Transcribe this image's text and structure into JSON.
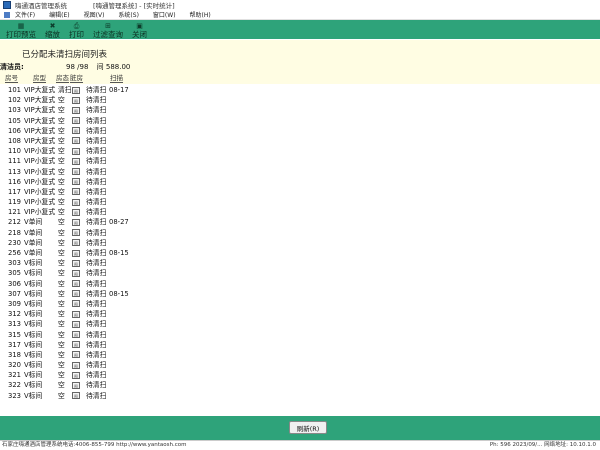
{
  "window": {
    "app_title": "嗨通酒店管理系统",
    "doc_title": "[嗨通管理系统] - [实时统计]"
  },
  "menu": [
    "文件(F)",
    "编辑(E)",
    "视图(V)",
    "系统(S)",
    "窗口(W)",
    "帮助(H)"
  ],
  "toolbar": [
    {
      "label": "打印预览",
      "icon": "▦"
    },
    {
      "label": "缩放",
      "icon": "✖"
    },
    {
      "label": "打印",
      "icon": "⎙"
    },
    {
      "label": "过滤查询",
      "icon": "⊞"
    },
    {
      "label": "关闭",
      "icon": "▣"
    }
  ],
  "report": {
    "title": "已分配未清扫房间列表",
    "cleaner_label": "清洁员:",
    "count": "98 /98",
    "amount": "间 588.00"
  },
  "columns": [
    "房号",
    "房型",
    "房态",
    "脏房",
    "扫描"
  ],
  "rows": [
    {
      "no": "101",
      "type": "VIP大复式",
      "status": "清扫",
      "state": "待清扫",
      "date": "08-17"
    },
    {
      "no": "102",
      "type": "VIP大复式",
      "status": "空",
      "state": "待清扫",
      "date": ""
    },
    {
      "no": "103",
      "type": "VIP大复式",
      "status": "空",
      "state": "待清扫",
      "date": ""
    },
    {
      "no": "105",
      "type": "VIP大复式",
      "status": "空",
      "state": "待清扫",
      "date": ""
    },
    {
      "no": "106",
      "type": "VIP大复式",
      "status": "空",
      "state": "待清扫",
      "date": ""
    },
    {
      "no": "108",
      "type": "VIP大复式",
      "status": "空",
      "state": "待清扫",
      "date": ""
    },
    {
      "no": "110",
      "type": "VIP小复式",
      "status": "空",
      "state": "待清扫",
      "date": ""
    },
    {
      "no": "111",
      "type": "VIP小复式",
      "status": "空",
      "state": "待清扫",
      "date": ""
    },
    {
      "no": "113",
      "type": "VIP小复式",
      "status": "空",
      "state": "待清扫",
      "date": ""
    },
    {
      "no": "116",
      "type": "VIP小复式",
      "status": "空",
      "state": "待清扫",
      "date": ""
    },
    {
      "no": "117",
      "type": "VIP小复式",
      "status": "空",
      "state": "待清扫",
      "date": ""
    },
    {
      "no": "119",
      "type": "VIP小复式",
      "status": "空",
      "state": "待清扫",
      "date": ""
    },
    {
      "no": "121",
      "type": "VIP小复式",
      "status": "空",
      "state": "待清扫",
      "date": ""
    },
    {
      "no": "212",
      "type": "V单间",
      "status": "空",
      "state": "待清扫",
      "date": "08-27"
    },
    {
      "no": "218",
      "type": "V单间",
      "status": "空",
      "state": "待清扫",
      "date": ""
    },
    {
      "no": "230",
      "type": "V单间",
      "status": "空",
      "state": "待清扫",
      "date": ""
    },
    {
      "no": "256",
      "type": "V单间",
      "status": "空",
      "state": "待清扫",
      "date": "08-15"
    },
    {
      "no": "303",
      "type": "V标间",
      "status": "空",
      "state": "待清扫",
      "date": ""
    },
    {
      "no": "305",
      "type": "V标间",
      "status": "空",
      "state": "待清扫",
      "date": ""
    },
    {
      "no": "306",
      "type": "V标间",
      "status": "空",
      "state": "待清扫",
      "date": ""
    },
    {
      "no": "307",
      "type": "V标间",
      "status": "空",
      "state": "待清扫",
      "date": "08-15"
    },
    {
      "no": "309",
      "type": "V标间",
      "status": "空",
      "state": "待清扫",
      "date": ""
    },
    {
      "no": "312",
      "type": "V标间",
      "status": "空",
      "state": "待清扫",
      "date": ""
    },
    {
      "no": "313",
      "type": "V标间",
      "status": "空",
      "state": "待清扫",
      "date": ""
    },
    {
      "no": "315",
      "type": "V标间",
      "status": "空",
      "state": "待清扫",
      "date": ""
    },
    {
      "no": "317",
      "type": "V标间",
      "status": "空",
      "state": "待清扫",
      "date": ""
    },
    {
      "no": "318",
      "type": "V标间",
      "status": "空",
      "state": "待清扫",
      "date": ""
    },
    {
      "no": "320",
      "type": "V标间",
      "status": "空",
      "state": "待清扫",
      "date": ""
    },
    {
      "no": "321",
      "type": "V标间",
      "status": "空",
      "state": "待清扫",
      "date": ""
    },
    {
      "no": "322",
      "type": "V标间",
      "status": "空",
      "state": "待清扫",
      "date": ""
    },
    {
      "no": "323",
      "type": "V标间",
      "status": "空",
      "state": "待清扫",
      "date": ""
    }
  ],
  "checkbox_glyph": "图",
  "footer": {
    "refresh_label": "刷新(R)"
  },
  "statusbar": {
    "left": "石家庄嗨通酒店管理系统电话:4006-855-799 http://www.yantaosh.com",
    "right": "Ph: 596 2023/09/... 网络地址: 10.10.1.0"
  },
  "colors": {
    "toolbar_bg": "#2ea37a",
    "panel_bg": "#fffde3"
  }
}
